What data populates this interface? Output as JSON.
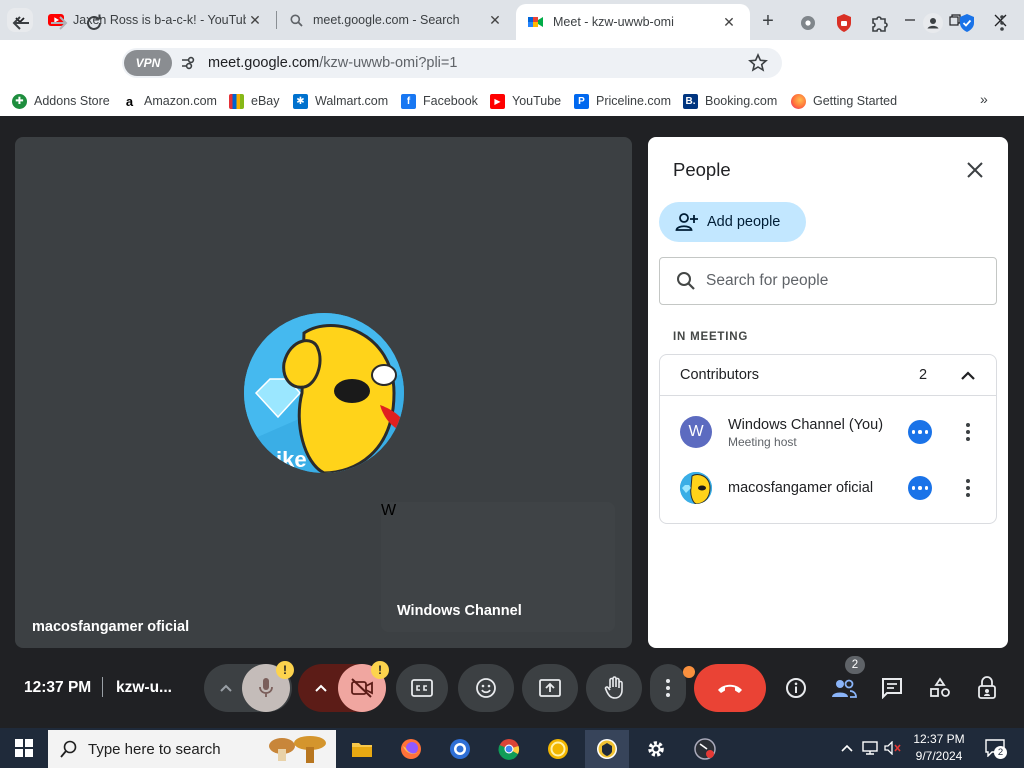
{
  "browser": {
    "tabs": [
      {
        "title": "Jaxen Ross is b-a-c-k! - YouTube",
        "icon": "youtube-icon"
      },
      {
        "title": "meet.google.com - Search",
        "icon": "search-icon"
      },
      {
        "title": "Meet - kzw-uwwb-omi",
        "icon": "google-meet-icon",
        "active": true
      }
    ],
    "vpn_label": "VPN",
    "url_host": "meet.google.com",
    "url_path": "/kzw-uwwb-omi?pli=1",
    "bookmarks": [
      {
        "label": "Addons Store",
        "icon": "addons-store-icon",
        "color": "#1e8e3e"
      },
      {
        "label": "Amazon.com",
        "icon": "amazon-icon",
        "color": "#000000"
      },
      {
        "label": "eBay",
        "icon": "ebay-icon",
        "color": "#e53238"
      },
      {
        "label": "Walmart.com",
        "icon": "walmart-icon",
        "color": "#0071ce"
      },
      {
        "label": "Facebook",
        "icon": "facebook-icon",
        "color": "#1877f2"
      },
      {
        "label": "YouTube",
        "icon": "youtube-icon",
        "color": "#ff0000"
      },
      {
        "label": "Priceline.com",
        "icon": "priceline-icon",
        "color": "#0068ef"
      },
      {
        "label": "Booking.com",
        "icon": "booking-icon",
        "color": "#003580"
      },
      {
        "label": "Getting Started",
        "icon": "firefox-icon",
        "color": "#ff7139"
      }
    ],
    "bookmarks_more": "»"
  },
  "meet": {
    "main_tile_name": "macosfangamer oficial",
    "main_avatar_text": "ike",
    "self_tile_name": "Windows Channel",
    "self_avatar_letter": "W",
    "time": "12:37 PM",
    "meeting_code": "kzw-u...",
    "people_badge": "2",
    "warn_mark": "!"
  },
  "panel": {
    "title": "People",
    "add_people": "Add people",
    "search_placeholder": "Search for people",
    "section": "IN MEETING",
    "group_label": "Contributors",
    "group_count": "2",
    "people": [
      {
        "name": "Windows Channel (You)",
        "sub": "Meeting host",
        "avatar_letter": "W",
        "avatar_color": "#5c6bc0"
      },
      {
        "name": "macosfangamer oficial",
        "sub": "",
        "avatar_letter": "",
        "avatar_color": "#2aa3e0"
      }
    ]
  },
  "taskbar": {
    "search_placeholder": "Type here to search",
    "time": "12:37 PM",
    "date": "9/7/2024",
    "notification_count": "2"
  },
  "colors": {
    "accent": "#1a73e8",
    "end_call": "#ea4335",
    "add_people_bg": "#c2e7ff",
    "stage_bg": "#202124",
    "tile_bg": "#3c4043"
  }
}
